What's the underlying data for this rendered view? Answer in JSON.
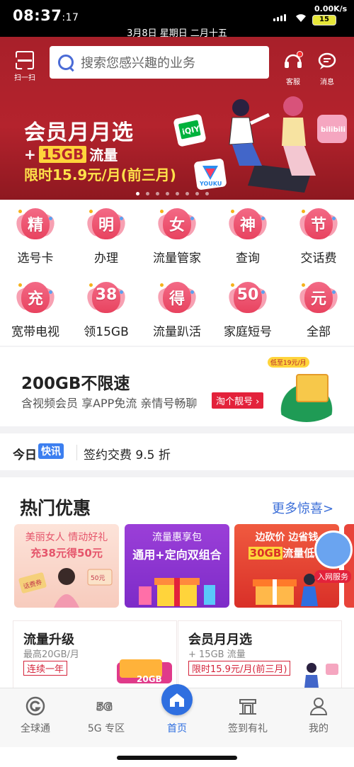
{
  "status_bar": {
    "time": "08:37",
    "seconds": ":17",
    "date": "3月8日 星期日 二月十五",
    "net_speed": "0.00K/s",
    "battery": "15"
  },
  "header": {
    "scan_label": "扫一扫",
    "search_placeholder": "搜索您感兴趣的业务",
    "service_label": "客服",
    "message_label": "消息"
  },
  "hero_banner": {
    "title": "会员月月选",
    "line2_prefix": "+",
    "line2_highlight": "15GB",
    "line2_suffix": "流量",
    "line3": "限时15.9元/月(前三月)",
    "logo_left": "iQIYI",
    "logo_right": "bilibili",
    "logo_youku": "YOUKU",
    "page_index": 1,
    "page_count": 8
  },
  "quick_grid": [
    {
      "glyph": "精",
      "label": "选号卡"
    },
    {
      "glyph": "明",
      "label": "办理"
    },
    {
      "glyph": "女",
      "label": "流量管家"
    },
    {
      "glyph": "神",
      "label": "查询"
    },
    {
      "glyph": "节",
      "label": "交话费"
    },
    {
      "glyph": "充",
      "label": "宽带电视"
    },
    {
      "glyph": "38",
      "label": "领15GB"
    },
    {
      "glyph": "得",
      "label": "流量趴活"
    },
    {
      "glyph": "50",
      "label": "家庭短号"
    },
    {
      "glyph": "元",
      "label": "全部"
    }
  ],
  "promo_banner": {
    "title": "200GB不限速",
    "subtitle": "含视频会员 享APP免流 亲情号畅聊",
    "button": "淘个靓号",
    "tag": "低至19元/月"
  },
  "news": {
    "prefix": "今日",
    "tag": "快讯",
    "text": "签约交费 9.5 折"
  },
  "hot": {
    "title": "热门优惠",
    "more": "更多惊喜>",
    "cards": [
      {
        "top": "美丽女人 情动好礼",
        "main": "充38元得50元",
        "extra1": "话费券",
        "extra2": "50元"
      },
      {
        "top": "流量惠享包",
        "main": "通用+定向双组合"
      },
      {
        "top": "边砍价 边省钱",
        "main_highlight": "30GB",
        "main_rest": "流量低价"
      }
    ],
    "floating_service": "入网服务",
    "sub_cards": [
      {
        "title": "流量升级",
        "sub": "最高20GB/月",
        "tag": "连续一年",
        "art": "20GB"
      },
      {
        "title": "会员月月选",
        "sub": "+ 15GB 流量",
        "tag": "限时15.9元/月(前三月)"
      }
    ]
  },
  "tabbar": [
    {
      "label": "全球通",
      "icon": "global-g-icon"
    },
    {
      "label": "5G 专区",
      "icon": "5g-icon"
    },
    {
      "label": "首页",
      "icon": "home-icon",
      "active": true
    },
    {
      "label": "签到有礼",
      "icon": "gift-building-icon"
    },
    {
      "label": "我的",
      "icon": "user-icon"
    }
  ],
  "colors": {
    "brand_red": "#b4232d",
    "accent_blue": "#2f6fe0",
    "petal_pink": "#e8435f",
    "highlight_yellow": "#ffd43b"
  }
}
